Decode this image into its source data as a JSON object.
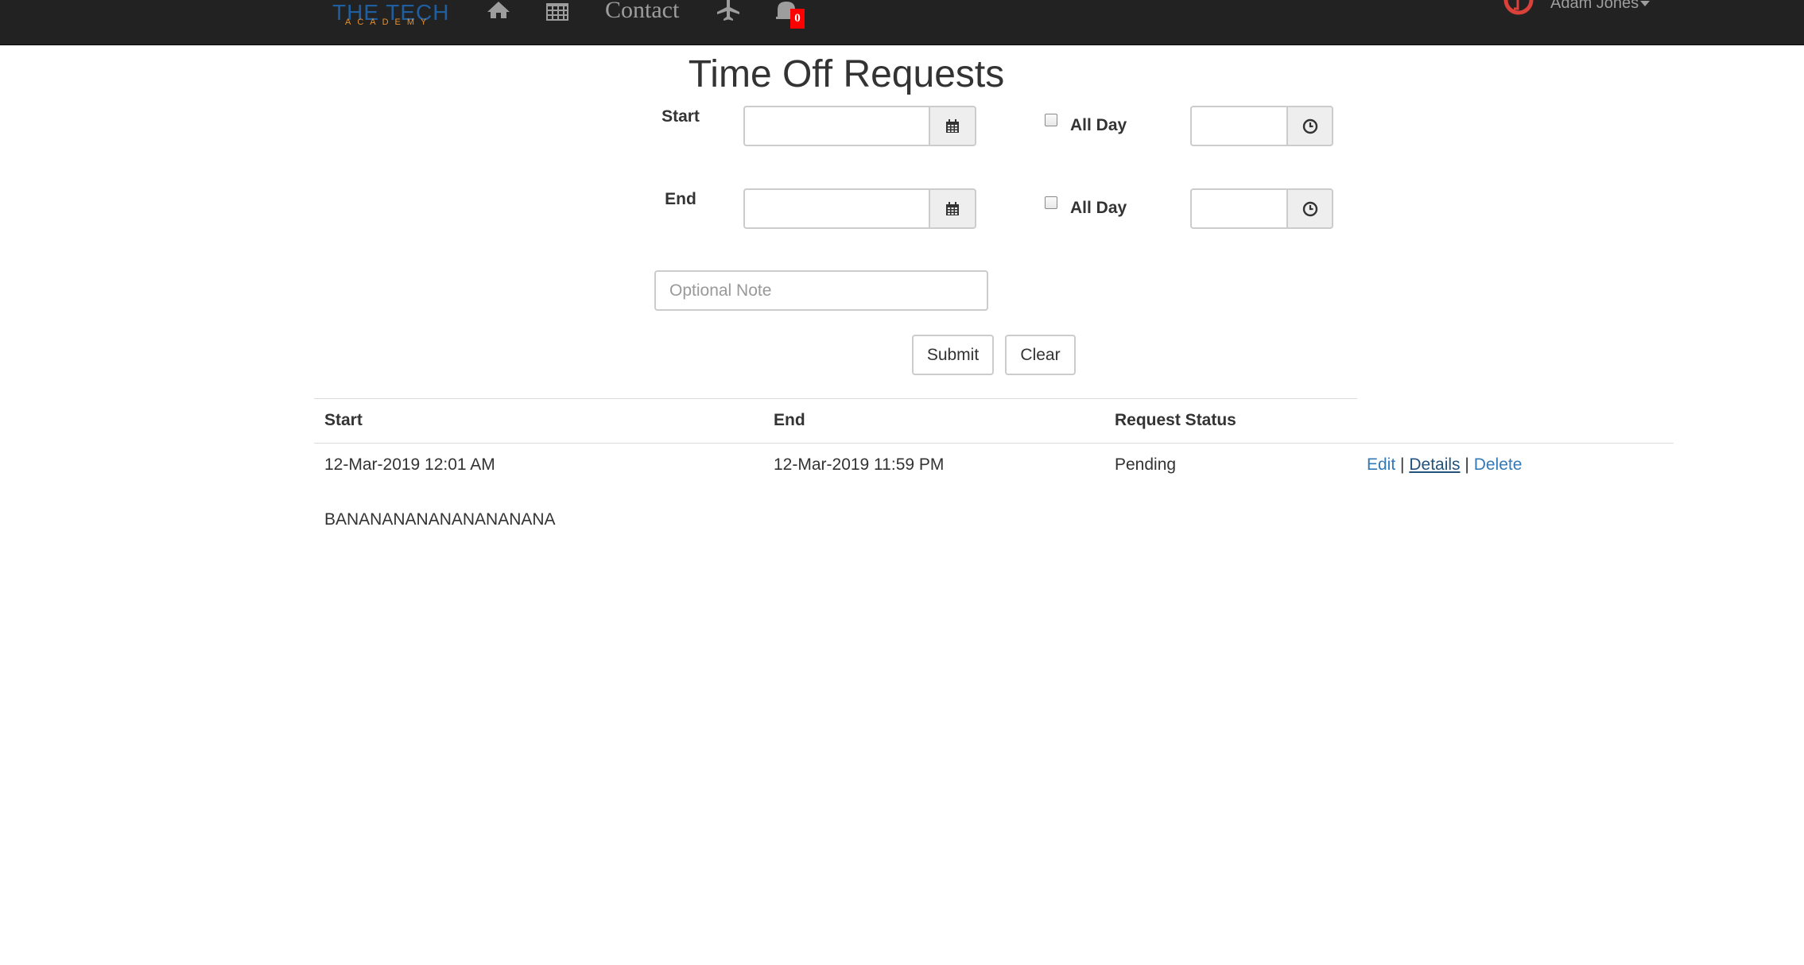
{
  "nav": {
    "logo_main": "THE TECH",
    "logo_sub": "ACADEMY",
    "contact_label": "Contact",
    "notifications_count": "0",
    "user_name": "Adam Jones"
  },
  "page": {
    "title": "Time Off Requests"
  },
  "form": {
    "start_label": "Start",
    "end_label": "End",
    "all_day_label": "All Day",
    "start_date_value": "",
    "start_time_value": "",
    "end_date_value": "",
    "end_time_value": "",
    "note_placeholder": "Optional Note",
    "submit_label": "Submit",
    "clear_label": "Clear"
  },
  "table": {
    "headers": {
      "start": "Start",
      "end": "End",
      "status": "Request Status"
    },
    "rows": [
      {
        "start": "12-Mar-2019 12:01 AM",
        "end": "12-Mar-2019 11:59 PM",
        "status": "Pending",
        "edit": "Edit",
        "details": "Details",
        "delete": "Delete",
        "separator": "|",
        "note": "BANANANANANANANANANA"
      }
    ]
  },
  "colors": {
    "navbar_bg": "#222222",
    "link": "#337ab7",
    "badge": "#ff0000",
    "logo_blue": "#1f5fa0",
    "logo_orange": "#e8902c",
    "clock_red": "#d9413a"
  }
}
